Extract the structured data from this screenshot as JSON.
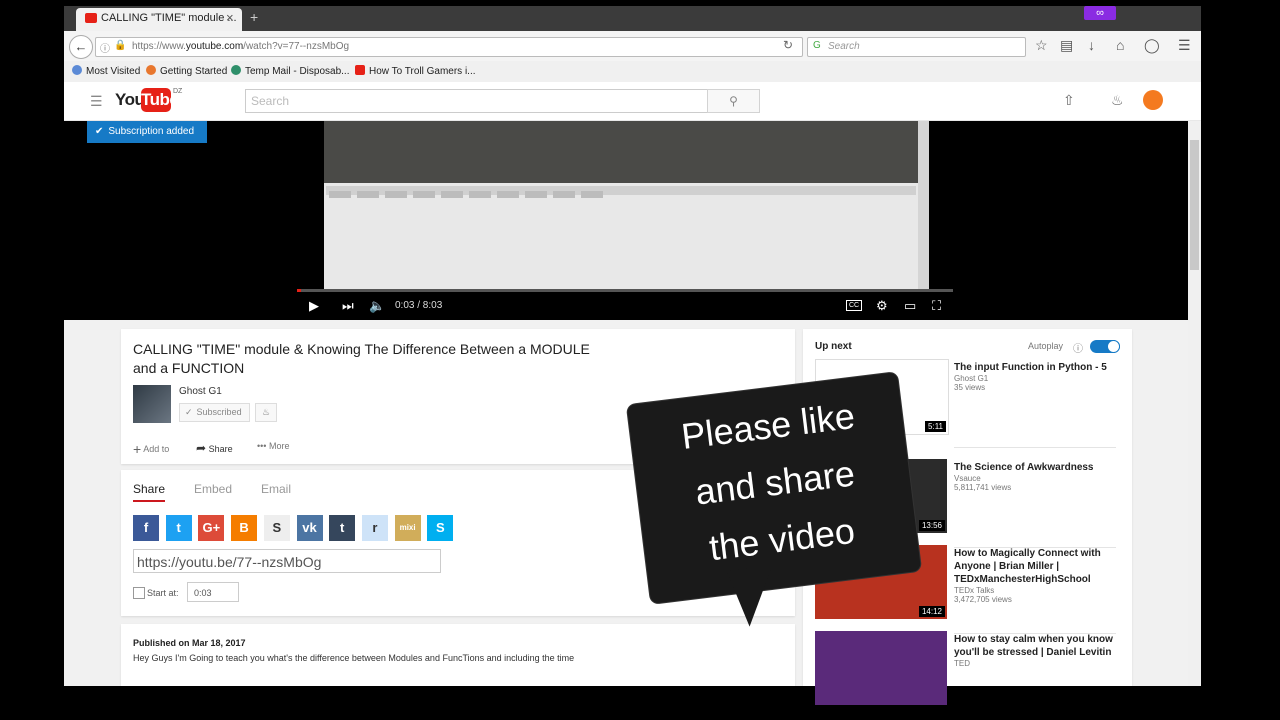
{
  "browser": {
    "tab_title": "CALLING \"TIME\" module ...",
    "tab_close": "×",
    "new_tab": "+",
    "private_badge": "∞",
    "url_prefix": "https://www.",
    "url_host": "youtube.com",
    "url_path": "/watch?v=77--nzsMbOg",
    "search_placeholder": "Search",
    "bookmarks": [
      {
        "label": "Most Visited",
        "color": "#5b8ad6"
      },
      {
        "label": "Getting Started",
        "color": "#e8772e"
      },
      {
        "label": "Temp Mail - Disposab...",
        "color": "#2f8f6a"
      },
      {
        "label": "How To Troll Gamers i...",
        "color": "#e62117"
      }
    ]
  },
  "youtube": {
    "logo_you": "You",
    "logo_tube": "Tube",
    "logo_region": "DZ",
    "search_placeholder": "Search",
    "toast": "Subscription added"
  },
  "player": {
    "time": "0:03 / 8:03",
    "progress": 0.006
  },
  "video": {
    "title": "CALLING \"TIME\" module & Knowing The Difference Between a MODULE and a FUNCTION",
    "channel": "Ghost G1",
    "subscribed_label": "Subscribed",
    "actions": {
      "add_to": "Add to",
      "share": "Share",
      "more": "More"
    },
    "share_tabs": [
      "Share",
      "Embed",
      "Email"
    ],
    "share_icons": [
      {
        "label": "f",
        "color": "#3b5998"
      },
      {
        "label": "t",
        "color": "#1da1f2"
      },
      {
        "label": "G+",
        "color": "#dd4b39"
      },
      {
        "label": "B",
        "color": "#f57d00"
      },
      {
        "label": "S",
        "color": "#eeeeee"
      },
      {
        "label": "vk",
        "color": "#4c75a3"
      },
      {
        "label": "t",
        "color": "#35465c"
      },
      {
        "label": "r",
        "color": "#cee3f8"
      },
      {
        "label": "mixi",
        "color": "#d1ad5a"
      },
      {
        "label": "S",
        "color": "#00aff0"
      }
    ],
    "share_url": "https://youtu.be/77--nzsMbOg",
    "start_at_label": "Start at:",
    "start_at_value": "0:03",
    "published": "Published on Mar 18, 2017",
    "description": "Hey Guys I'm Going to teach you what's the difference between Modules and FuncTions and including the time"
  },
  "sidebar": {
    "up_next": "Up next",
    "autoplay": "Autoplay",
    "videos": [
      {
        "title": "The input Function in Python - 5",
        "channel": "Ghost G1",
        "views": "35 views",
        "duration": "5:11",
        "thumb": "#ffffff"
      },
      {
        "title": "The Science of Awkwardness",
        "channel": "Vsauce",
        "views": "5,811,741 views",
        "duration": "13:56",
        "thumb": "#2b2b2b"
      },
      {
        "title": "How to Magically Connect with Anyone | Brian Miller | TEDxManchesterHighSchool",
        "channel": "TEDx Talks",
        "views": "3,472,705 views",
        "duration": "14:12",
        "thumb": "#b8321f"
      },
      {
        "title": "How to stay calm when you know you'll be stressed | Daniel Levitin",
        "channel": "TED",
        "views": "",
        "duration": "",
        "thumb": "#5a2a7a"
      }
    ]
  },
  "overlay": {
    "line1": "Please like",
    "line2": "and share",
    "line3": "the video"
  }
}
